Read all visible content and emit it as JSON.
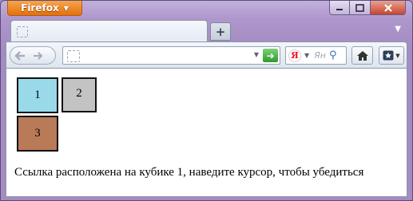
{
  "browser": {
    "app_button_label": "Firefox",
    "tab": {
      "title": ""
    },
    "url": "",
    "search": {
      "engine_logo": "Я",
      "placeholder": "Ян"
    },
    "icons": {
      "app_menu": "caret-down-icon",
      "minimize": "minimize-icon",
      "maximize": "maximize-icon",
      "close": "close-icon",
      "new_tab": "plus-icon",
      "tab_list": "chevron-down-icon",
      "back": "back-arrow-icon",
      "forward": "forward-arrow-icon",
      "go": "go-arrow-icon",
      "search": "magnifier-icon",
      "home": "home-icon",
      "bookmarks": "bookmarks-icon"
    },
    "colors": {
      "app_button": "#e2700f",
      "go_button": "#2e9a2a",
      "title_bar": "#a68cc4"
    }
  },
  "page": {
    "cubes": [
      {
        "label": "1",
        "color": "#99d9ea"
      },
      {
        "label": "2",
        "color": "#c3c3c3"
      },
      {
        "label": "3",
        "color": "#b97a57"
      }
    ],
    "message": "Ссылка расположена на кубике 1, наведите курсор, чтобы убедиться"
  }
}
